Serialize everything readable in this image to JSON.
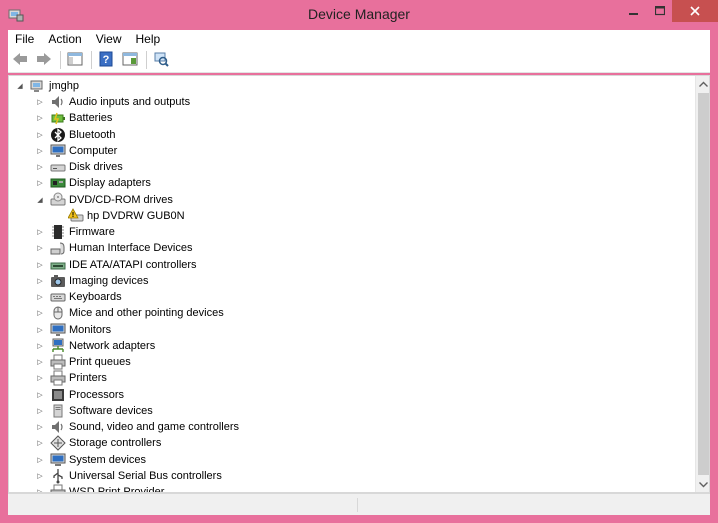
{
  "window": {
    "title": "Device Manager"
  },
  "menu": [
    "File",
    "Action",
    "View",
    "Help"
  ],
  "toolbar": [
    {
      "icon": "back-arrow-icon"
    },
    {
      "icon": "forward-arrow-icon"
    },
    {
      "icon": "show-hide-console-tree-icon"
    },
    {
      "icon": "help-icon"
    },
    {
      "icon": "properties-icon"
    },
    {
      "icon": "scan-hardware-changes-icon"
    }
  ],
  "tree": {
    "root": {
      "label": "jmghp",
      "expanded": true,
      "icon": "computer-root-icon"
    },
    "items": [
      {
        "label": "Audio inputs and outputs",
        "icon": "speaker-icon",
        "level": 1,
        "expanded": false
      },
      {
        "label": "Batteries",
        "icon": "battery-icon",
        "level": 1,
        "expanded": false
      },
      {
        "label": "Bluetooth",
        "icon": "bluetooth-icon",
        "level": 1,
        "expanded": false
      },
      {
        "label": "Computer",
        "icon": "monitor-icon",
        "level": 1,
        "expanded": false
      },
      {
        "label": "Disk drives",
        "icon": "disk-drive-icon",
        "level": 1,
        "expanded": false
      },
      {
        "label": "Display adapters",
        "icon": "display-adapter-icon",
        "level": 1,
        "expanded": false
      },
      {
        "label": "DVD/CD-ROM drives",
        "icon": "dvd-drive-icon",
        "level": 1,
        "expanded": true
      },
      {
        "label": "hp DVDRW  GUB0N",
        "icon": "warning-dvd-icon",
        "level": 2,
        "expanded": null
      },
      {
        "label": "Firmware",
        "icon": "chip-icon",
        "level": 1,
        "expanded": false
      },
      {
        "label": "Human Interface Devices",
        "icon": "hid-icon",
        "level": 1,
        "expanded": false
      },
      {
        "label": "IDE ATA/ATAPI controllers",
        "icon": "ide-controller-icon",
        "level": 1,
        "expanded": false
      },
      {
        "label": "Imaging devices",
        "icon": "camera-icon",
        "level": 1,
        "expanded": false
      },
      {
        "label": "Keyboards",
        "icon": "keyboard-icon",
        "level": 1,
        "expanded": false
      },
      {
        "label": "Mice and other pointing devices",
        "icon": "mouse-icon",
        "level": 1,
        "expanded": false
      },
      {
        "label": "Monitors",
        "icon": "monitor-icon",
        "level": 1,
        "expanded": false
      },
      {
        "label": "Network adapters",
        "icon": "network-icon",
        "level": 1,
        "expanded": false
      },
      {
        "label": "Print queues",
        "icon": "printer-icon",
        "level": 1,
        "expanded": false
      },
      {
        "label": "Printers",
        "icon": "printer-icon",
        "level": 1,
        "expanded": false
      },
      {
        "label": "Processors",
        "icon": "processor-icon",
        "level": 1,
        "expanded": false
      },
      {
        "label": "Software devices",
        "icon": "software-device-icon",
        "level": 1,
        "expanded": false
      },
      {
        "label": "Sound, video and game controllers",
        "icon": "speaker-icon",
        "level": 1,
        "expanded": false
      },
      {
        "label": "Storage controllers",
        "icon": "storage-controller-icon",
        "level": 1,
        "expanded": false
      },
      {
        "label": "System devices",
        "icon": "system-device-icon",
        "level": 1,
        "expanded": false
      },
      {
        "label": "Universal Serial Bus controllers",
        "icon": "usb-icon",
        "level": 1,
        "expanded": false
      },
      {
        "label": "WSD Print Provider",
        "icon": "printer-icon",
        "level": 1,
        "expanded": false
      }
    ]
  },
  "colors": {
    "frame": "#e8709c",
    "close_button": "#c75050"
  }
}
